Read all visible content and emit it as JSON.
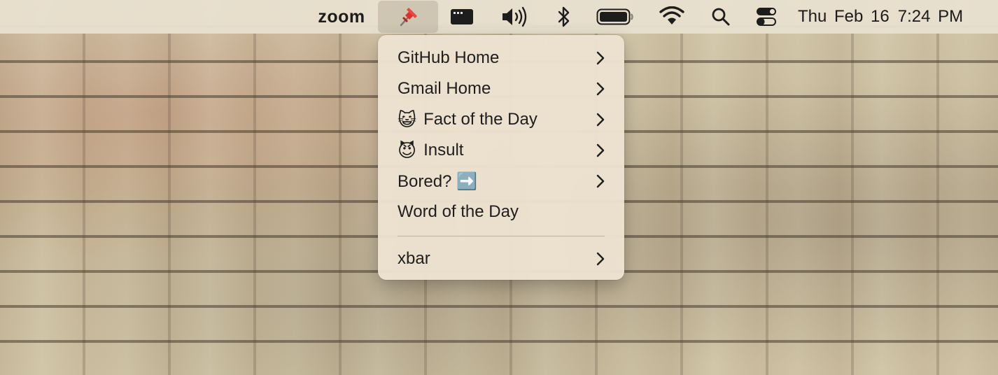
{
  "menubar": {
    "app_name": "zoom",
    "icons": [
      "pushpin-icon",
      "window-icon",
      "volume-icon",
      "bluetooth-icon",
      "battery-icon",
      "wifi-icon",
      "search-icon",
      "control-center-icon"
    ],
    "clock_date": "Thu Feb 16",
    "clock_time": "7:24 PM"
  },
  "menu": {
    "items": [
      {
        "label": "GitHub Home",
        "emoji": "",
        "submenu": true
      },
      {
        "label": "Gmail Home",
        "emoji": "",
        "submenu": true
      },
      {
        "label": "Fact of the Day",
        "emoji": "😺",
        "submenu": true
      },
      {
        "label": "Insult",
        "emoji": "😈",
        "submenu": true
      },
      {
        "label": "Bored? ➡️",
        "emoji": "",
        "submenu": true
      },
      {
        "label": "Word of the Day",
        "emoji": "",
        "submenu": false
      }
    ],
    "footer_item": {
      "label": "xbar",
      "submenu": true
    }
  },
  "colors": {
    "menubar_bg": "#e8e0ce",
    "menu_bg": "#ece2cf",
    "text": "#1e1e1e",
    "pushpin_red": "#d9332b"
  }
}
